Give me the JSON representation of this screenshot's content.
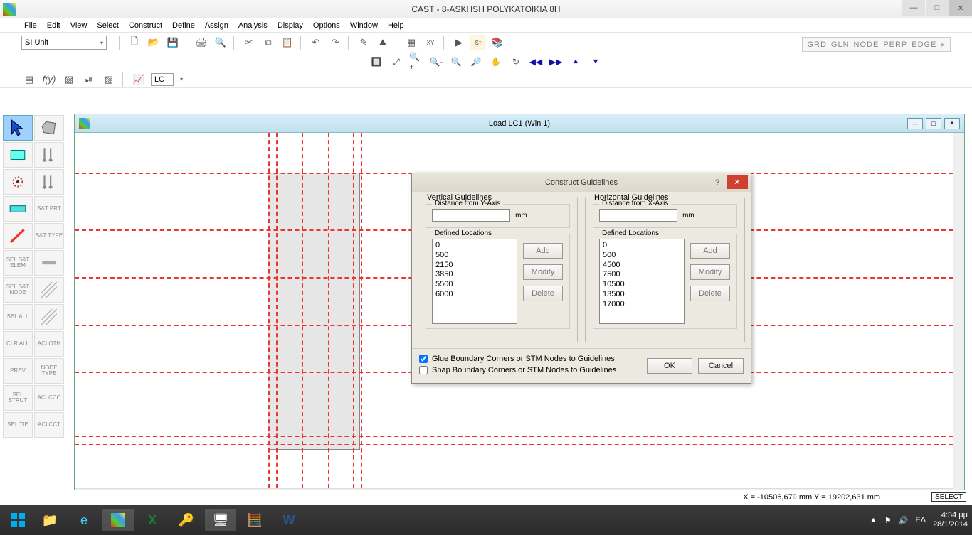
{
  "app": {
    "title": "CAST - 8-ASKHSH POLYKATOIKIA 8H"
  },
  "menu": {
    "items": [
      "File",
      "Edit",
      "View",
      "Select",
      "Construct",
      "Define",
      "Assign",
      "Analysis",
      "Display",
      "Options",
      "Window",
      "Help"
    ]
  },
  "snapbar": {
    "items": [
      "GRD",
      "GLN",
      "NODE",
      "PERP",
      "EDGE"
    ]
  },
  "unit": {
    "value": "SI Unit"
  },
  "lc": {
    "value": "LC"
  },
  "docwin": {
    "title": "Load LC1 (Win 1)"
  },
  "status": {
    "coords": "X = -10506,679 mm   Y = 19202,631 mm",
    "mode": "SELECT"
  },
  "tray": {
    "lang": "ΕΛ",
    "time": "4:54 μμ",
    "date": "28/1/2014"
  },
  "dialog": {
    "title": "Construct Guidelines",
    "vertical": {
      "legend": "Vertical Guidelines",
      "distance_legend": "Distance from Y-Axis",
      "unit": "mm",
      "defined_legend": "Defined Locations",
      "items": [
        "0",
        "500",
        "2150",
        "3850",
        "5500",
        "6000"
      ],
      "add": "Add",
      "modify": "Modify",
      "delete": "Delete"
    },
    "horizontal": {
      "legend": "Horizontal Guidelines",
      "distance_legend": "Distance from X-Axis",
      "unit": "mm",
      "defined_legend": "Defined Locations",
      "items": [
        "0",
        "500",
        "4500",
        "7500",
        "10500",
        "13500",
        "17000"
      ],
      "add": "Add",
      "modify": "Modify",
      "delete": "Delete"
    },
    "glue_label": "Glue Boundary Corners or STM Nodes to Guidelines",
    "snap_label": "Snap Boundary Corners or STM Nodes to Guidelines",
    "ok": "OK",
    "cancel": "Cancel"
  },
  "left": {
    "col1": [
      "",
      "",
      "",
      "",
      "",
      "SEL S&T ELEM",
      "SEL S&T NODE",
      "SEL ALL",
      "CLR ALL",
      "PREV",
      "SEL STRUT",
      "SEL TIE"
    ],
    "col2": [
      "",
      "",
      "",
      "S&T PRT",
      "S&T TYPE",
      "",
      "",
      "",
      "ACI OTH",
      "NODE TYPE",
      "ACI CCC",
      "ACI CCT"
    ]
  }
}
